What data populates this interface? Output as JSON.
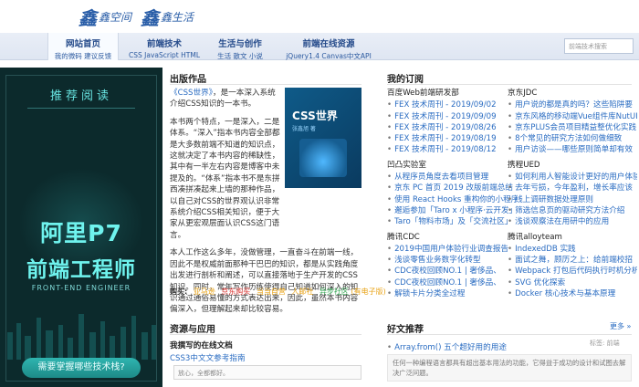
{
  "header": {
    "logo_left": "鑫空间",
    "logo_right": "鑫生活"
  },
  "nav": [
    {
      "title": "网站首页",
      "sub": "我的微码  建议反馈"
    },
    {
      "title": "前端技术",
      "sub": "CSS  JavaScript  HTML"
    },
    {
      "title": "生活与创作",
      "sub": "生活  散文  小说"
    },
    {
      "title": "前端在线资源",
      "sub": "jQuery1.4  Canvas中文API"
    }
  ],
  "search": {
    "placeholder": "前端技术搜索"
  },
  "banner": {
    "recommend": "推荐阅读",
    "title1": "阿里P7",
    "title2": "前端工程师",
    "english": "FRONT-END ENGINEER",
    "cta": "需要掌握哪些技术栈?"
  },
  "works": {
    "title": "出版作品",
    "p1_link": "《CSS世界》",
    "p1_rest": "，是一本深入系统介绍CSS知识的一本书。",
    "p2": "本书两个特点，一是深入，二是体系。“深入”指本书内容全部都是大多数前端不知道的知识点，这就决定了本书内容的稀缺性，其中有一半左右内容是博客中未提及的。“体系”指本书不是东拼西凑拼凑起来上墙的那种作品，以自己对CSS的世界观认识非常系统介绍CSS相关知识，便于大家从更宏观层面认识CSS这门语言。",
    "p3": "本人工作这么多年，没做管理，一直奋斗在前端一线，因此不是权威前面那种干巴巴的知识，都是从实践角度出发进行剖析和阐述，可以直接落地于生产开发的CSS知识。同时，常年写作历练使得自己知道如何深入的知识通过通俗易懂的方式表达出来，因此，虽然本书内容偏深入，但理解起来却比较容易。",
    "book_title": "CSS世界",
    "book_sub": "张鑫旭 著",
    "buy_label": "购买:",
    "stores": [
      {
        "name": "亚马逊",
        "color": "#e8a317"
      },
      {
        "name": "京东购买",
        "color": "#d9302c"
      },
      {
        "name": "当当自营",
        "color": "#e8a317"
      },
      {
        "name": "人邮社",
        "color": "#e8a317"
      },
      {
        "name": "异步社区",
        "color": "#34a853"
      },
      {
        "name": "(有电子版)",
        "color": "#e8a317"
      }
    ]
  },
  "subs": {
    "title": "我的订阅",
    "left": [
      {
        "name": "百度Web前端研发部",
        "items": [
          "FEX 技术周刊 - 2019/09/02",
          "FEX 技术周刊 - 2019/09/09",
          "FEX 技术周刊 - 2019/08/26",
          "FEX 技术周刊 - 2019/08/19",
          "FEX 技术周刊 - 2019/08/12"
        ]
      },
      {
        "name": "凹凸实验室",
        "items": [
          "从程序员角度去看项目管理",
          "京东 PC 首页 2019 改版前端总结",
          "使用 React Hooks 重构你的小程序",
          "邂逅参加「Taro x 小程序·云开发」",
          "Taro「物料市场」及「交流社区」"
        ]
      },
      {
        "name": "腾讯CDC",
        "items": [
          "2019中国用户体验行业调查报告",
          "浅谈零售业务数字化转型",
          "CDC夜校回顾NO.1 | 奢侈品、",
          "CDC夜校回顾NO.1 | 奢侈品、",
          "解锁卡片分类全过程"
        ]
      }
    ],
    "right": [
      {
        "name": "京东JDC",
        "items": [
          "用户说的都是真的吗？这些陷阱要",
          "京东风格的移动端Vue组件库NutUI",
          "京东PLUS会员项目精益整优化实践",
          "8个常见的研究方法如何做细致",
          "用户访谈——哪些原则简单却有效"
        ]
      },
      {
        "name": "携程UED",
        "items": [
          "如何利用人智能设计更好的用户体验",
          "去年亏损，今年盈利，增长率应该",
          "线上调研数据处理原则",
          "筛选信息页的驱动研究方法介绍",
          "浅谈观察法在用研中的应用"
        ]
      },
      {
        "name": "腾讯alloyteam",
        "items": [
          "IndexedDB 实践",
          "面试之舞，顾历之上：给前端校招",
          "Webpack 打包后代码执行时机分析",
          "SVG 优化探索",
          "Docker 核心技术与基本原理"
        ]
      }
    ]
  },
  "resources": {
    "title": "资源与应用",
    "sub": "我撰写的在线文档",
    "link": "CSS3中文文参考指南",
    "input_value": "放心，全都都好。"
  },
  "recommend": {
    "title": "好文推荐",
    "more": "更多 »",
    "tag": "标签: 前端",
    "link": "Array.from() 五个超好用的用途",
    "desc": "任何一种编程语言都具有超出基本用法的功能，它得益于成功的设计和试图去解决广泛问题。"
  }
}
